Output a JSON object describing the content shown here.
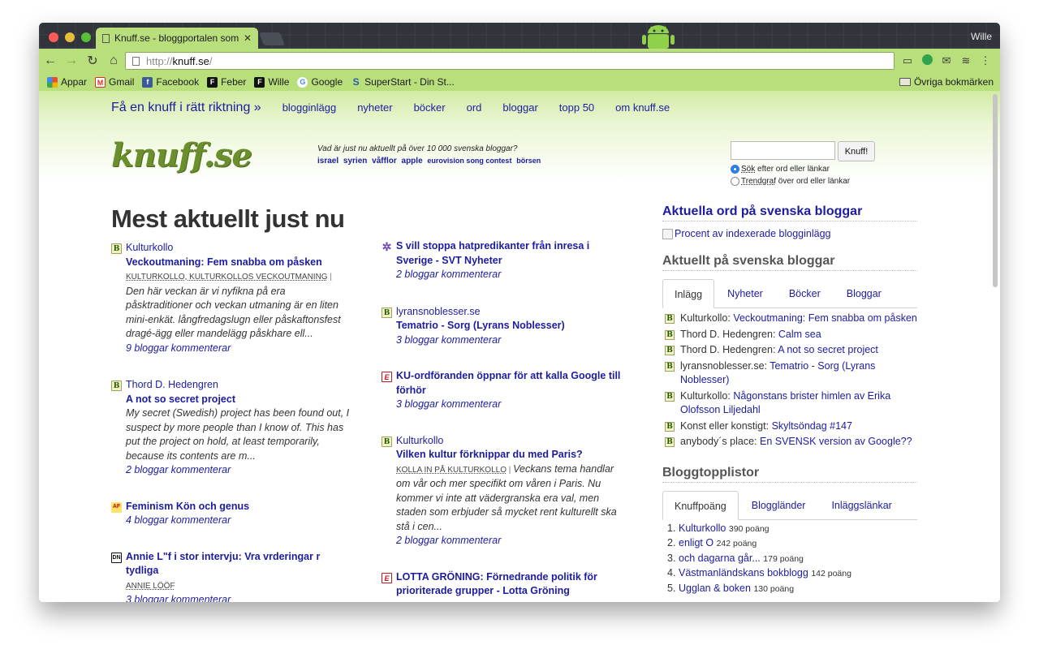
{
  "browser": {
    "tab_title": "Knuff.se - bloggportalen som",
    "user": "Wille",
    "url_proto": "http://",
    "url_host": "knuff.se",
    "url_path": "/",
    "bookmarks": [
      {
        "label": "Appar",
        "icon": "apps-icon",
        "color": "#e5502f"
      },
      {
        "label": "Gmail",
        "icon": "gmail-icon",
        "color": "#d93025"
      },
      {
        "label": "Facebook",
        "icon": "facebook-icon",
        "color": "#3b5998"
      },
      {
        "label": "Feber",
        "icon": "feber-icon",
        "color": "#111111"
      },
      {
        "label": "Wille",
        "icon": "wille-icon",
        "color": "#111111"
      },
      {
        "label": "Google",
        "icon": "google-icon",
        "color": "#4285f4"
      },
      {
        "label": "SuperStart - Din St...",
        "icon": "superstart-icon",
        "color": "#2a5caa"
      }
    ],
    "other_bookmarks": "Övriga bokmärken"
  },
  "site": {
    "slogan": "Få en knuff i rätt riktning »",
    "nav": [
      "blogginlägg",
      "nyheter",
      "böcker",
      "ord",
      "bloggar",
      "topp 50",
      "om knuff.se"
    ],
    "logo": "knuff.se",
    "tagline_question": "Vad är just nu aktuellt på över 10 000 svenska bloggar?",
    "tagline_words": [
      "israel",
      "syrien",
      "våfflor",
      "apple",
      "eurovision song contest",
      "börsen"
    ],
    "search": {
      "button": "Knuff!",
      "radio1_a": "Sök",
      "radio1_b": " efter ord eller länkar",
      "radio2_a": "Trendgraf",
      "radio2_b": " över ord eller länkar"
    },
    "heading": "Mest aktuellt just nu"
  },
  "column1": [
    {
      "fav": "B",
      "blog": "Kulturkollo",
      "title": "Veckoutmaning: Fem snabba om påsken",
      "tags": "KULTURKOLLO, KULTURKOLLOS VECKOUTMANING",
      "tags_sep": " |",
      "excerpt": "Den här veckan är vi nyfikna på era påsktraditioner och veckan utmaning är en liten mini-enkät. långfredagslugn eller påskaftonsfest dragé-ägg eller mandelägg påskhare ell...",
      "comments": "9 bloggar kommenterar"
    },
    {
      "fav": "B",
      "blog": "Thord D. Hedengren",
      "title": "A not so secret project",
      "excerpt": "My secret (Swedish) project has been found out, I suspect by more people than I know of. This has put the project on hold, at least temporarily, because its contents are m...",
      "comments": "2 bloggar kommenterar"
    },
    {
      "fav": "AF",
      "title": "Feminism Kön och genus",
      "comments": "4 bloggar kommenterar"
    },
    {
      "fav": "DN",
      "title": "Annie L\"f i stor intervju: Vra vrderingar r tydliga",
      "tags": "ANNIE LÖÖF",
      "comments": "3 bloggar kommenterar"
    }
  ],
  "column2": [
    {
      "fav": "✲",
      "title": "S vill stoppa hatpredikanter från inresa i Sverige - SVT Nyheter",
      "comments": "2 bloggar kommenterar"
    },
    {
      "fav": "B",
      "blog": "lyransnoblesser.se",
      "title": "Tematrio - Sorg (Lyrans Noblesser)",
      "comments": "3 bloggar kommenterar"
    },
    {
      "fav": "E",
      "title": "KU-ordföranden öppnar för att kalla Google till förhör",
      "comments": "3 bloggar kommenterar"
    },
    {
      "fav": "B",
      "blog": "Kulturkollo",
      "title": "Vilken kultur förknippar du med Paris?",
      "tags": "KOLLA IN PÅ KULTURKOLLO",
      "tags_sep": " | ",
      "excerpt": "Veckans tema handlar om vår och mer specifikt om våren i Paris. Nu kommer vi inte att vädergranska era val, men staden som erbjuder så mycket rent kulturellt ska stå i cen...",
      "comments": "2 bloggar kommenterar"
    },
    {
      "fav": "E",
      "title": "LOTTA GRÖNING: Förnedrande politik för prioriterade grupper - Lotta Gröning"
    }
  ],
  "sidebar": {
    "h_words": "Aktuella ord på svenska bloggar",
    "img_alt": "Procent av indexerade blogginlägg",
    "h_current": "Aktuellt på svenska bloggar",
    "tabs": [
      "Inlägg",
      "Nyheter",
      "Böcker",
      "Bloggar"
    ],
    "posts": [
      {
        "blog": "Kulturkollo",
        "title": "Veckoutmaning: Fem snabba om påsken"
      },
      {
        "blog": "Thord D. Hedengren",
        "title": "Calm sea"
      },
      {
        "blog": "Thord D. Hedengren",
        "title": "A not so secret project"
      },
      {
        "blog": "lyransnoblesser.se",
        "title": "Tematrio - Sorg (Lyrans Noblesser)"
      },
      {
        "blog": "Kulturkollo",
        "title": "Någonstans brister himlen av Erika Olofsson Liljedahl"
      },
      {
        "blog": "Konst eller konstigt",
        "title": "Skyltsöndag #147"
      },
      {
        "blog": "anybody´s place",
        "title": "En SVENSK version av Google??"
      }
    ],
    "h_top": "Bloggtopplistor",
    "top_tabs": [
      "Knuffpoäng",
      "Bloggländer",
      "Inläggslänkar"
    ],
    "top": [
      {
        "n": "1.",
        "name": "Kulturkollo",
        "pts": "390 poäng"
      },
      {
        "n": "2.",
        "name": "enligt O",
        "pts": "242 poäng"
      },
      {
        "n": "3.",
        "name": "och dagarna går...",
        "pts": "179 poäng"
      },
      {
        "n": "4.",
        "name": "Västmanländskans bokblogg",
        "pts": "142 poäng"
      },
      {
        "n": "5.",
        "name": "Ugglan & boken",
        "pts": "130 poäng"
      }
    ]
  }
}
